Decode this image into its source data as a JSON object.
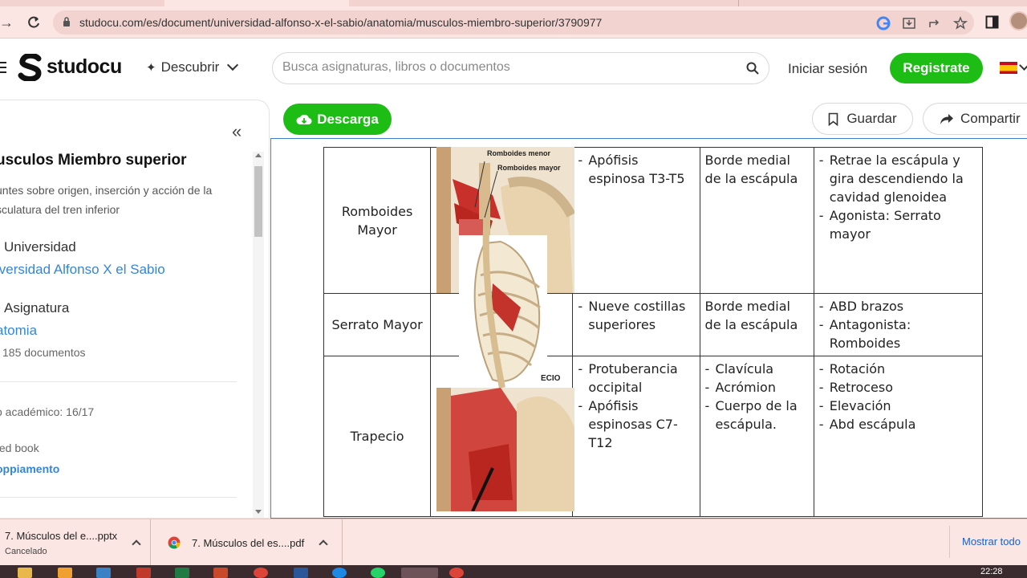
{
  "browser": {
    "url": "studocu.com/es/document/universidad-alfonso-x-el-sabio/anatomia/musculos-miembro-superior/3790977"
  },
  "header": {
    "logo_text": "studocu",
    "discover_label": "Descubrir",
    "search_placeholder": "Busca asignaturas, libros o documentos",
    "login_label": "Iniciar sesión",
    "register_label": "Registrate"
  },
  "sidebar": {
    "title": "usculos Miembro superior",
    "description": "untes sobre origen, inserción y acción de la sculatura del tren inferior",
    "university_label": "Universidad",
    "university_value": "iversidad Alfonso X el Sabio",
    "subject_label": "Asignatura",
    "subject_value": "atomia",
    "subject_count": "185 documentos",
    "academic_year": "o académico: 16/17",
    "book_label": "ted book",
    "book_value": "oppiamento"
  },
  "actions": {
    "download_label": "Descarga",
    "save_label": "Guardar",
    "share_label": "Compartir"
  },
  "document": {
    "image_labels": {
      "rhomboid_minor": "Romboides menor",
      "rhomboid_major": "Romboides mayor",
      "trapezius": "ECIO"
    },
    "rows": [
      {
        "muscle": "Romboides Mayor",
        "origin": [
          "Apófisis espinosa T3-T5"
        ],
        "insertion": [
          "Borde medial de la escápula"
        ],
        "action": [
          "Retrae la escápula y gira descendiendo la cavidad glenoidea",
          "Agonista: Serrato mayor"
        ],
        "insertion_bulleted": false
      },
      {
        "muscle": "Serrato Mayor",
        "origin": [
          "Nueve costillas superiores"
        ],
        "insertion": [
          "Borde medial de la escápula"
        ],
        "action": [
          "ABD brazos",
          "Antagonista: Romboides"
        ],
        "insertion_bulleted": false
      },
      {
        "muscle": "Trapecio",
        "origin": [
          "Protuberancia occipital",
          "Apófisis espinosas C7-T12"
        ],
        "insertion": [
          "Clavícula",
          "Acrómion",
          "Cuerpo de la escápula."
        ],
        "action": [
          "Rotación",
          "Retroceso",
          "Elevación",
          "Abd escápula"
        ],
        "insertion_bulleted": true
      }
    ]
  },
  "downloads": [
    {
      "name": "7. Músculos del e....pptx",
      "status": "Cancelado"
    },
    {
      "name": "7. Músculos del es....pdf",
      "status": ""
    }
  ],
  "downloads_show_all": "Mostrar todo",
  "taskbar": {
    "time": "22:28"
  },
  "colors": {
    "brand_green": "#1ebd16",
    "link_blue": "#3585d8",
    "chrome_pink": "#fbe6e3"
  }
}
